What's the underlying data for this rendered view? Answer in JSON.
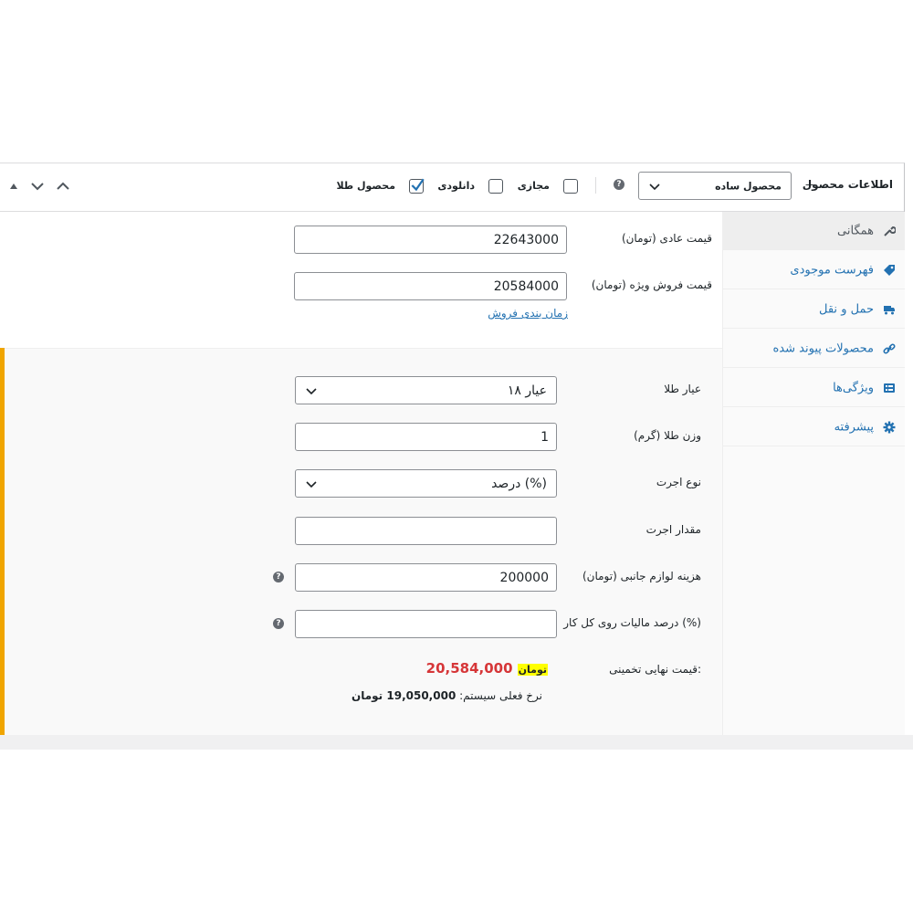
{
  "header": {
    "title": "اطلاعات محصول",
    "dash": "—",
    "product_type": {
      "selected": "محصول ساده"
    },
    "options": [
      {
        "label": "مجازی",
        "checked": false
      },
      {
        "label": "دانلودی",
        "checked": false
      },
      {
        "label": "محصول طلا",
        "checked": true
      }
    ],
    "help_icon": "?",
    "controls": [
      "arrow-up-icon",
      "arrow-down-icon",
      "collapse-triangle-icon"
    ]
  },
  "sidebar": {
    "items": [
      {
        "label": "همگانی",
        "icon": "wrench-icon",
        "active": true
      },
      {
        "label": "فهرست موجودی",
        "icon": "tag-icon",
        "active": false
      },
      {
        "label": "حمل و نقل",
        "icon": "truck-icon",
        "active": false
      },
      {
        "label": "محصولات پیوند شده",
        "icon": "link-icon",
        "active": false
      },
      {
        "label": "ویژگی‌ها",
        "icon": "list-icon",
        "active": false
      },
      {
        "label": "پیشرفته",
        "icon": "gear-icon",
        "active": false
      }
    ]
  },
  "pricing": {
    "regular_price": {
      "label": "قیمت عادی (تومان)",
      "value": "22643000"
    },
    "sale_price": {
      "label": "قیمت فروش ویژه (تومان)",
      "value": "20584000"
    },
    "schedule_link": "زمان بندی فروش"
  },
  "gold": {
    "karat": {
      "label": "عیار طلا",
      "value": "۱۸ عیار"
    },
    "weight": {
      "label": "وزن طلا (گرم)",
      "value": "1"
    },
    "wage_type": {
      "label": "نوع اجرت",
      "value": "درصد (%)"
    },
    "wage_amount": {
      "label": "مقدار اجرت",
      "value": ""
    },
    "accessories_cost": {
      "label": "هزینه لوازم جانبی (تومان)",
      "value": "200000"
    },
    "tax_percent": {
      "label": "درصد مالیات روی کل کار (%)",
      "value": ""
    },
    "final_price": {
      "label": "قیمت نهایی تخمینی:",
      "amount": "20,584,000",
      "currency": "تومان"
    },
    "system_rate": {
      "label": "نرخ فعلی سیستم:",
      "amount": "19,050,000 تومان"
    }
  },
  "colors": {
    "accent_link": "#2271b1",
    "gold_bar": "#f0a500",
    "price_red": "#d63638",
    "highlight": "#ffff00"
  }
}
